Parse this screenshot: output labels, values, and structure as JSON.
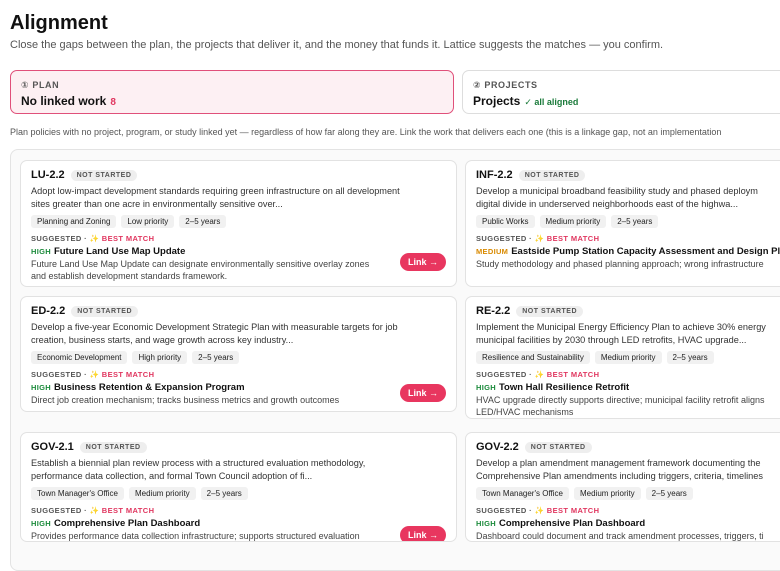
{
  "header": {
    "title": "Alignment",
    "subtitle": "Close the gaps between the plan, the projects that deliver it, and the money that funds it. Lattice suggests the matches — you confirm."
  },
  "tabs": {
    "plan": {
      "index": "①",
      "eyebrow": "PLAN",
      "label": "No linked work",
      "count": "8"
    },
    "projects": {
      "index": "②",
      "eyebrow": "PROJECTS",
      "label": "Projects",
      "status": "✓ all aligned"
    }
  },
  "note": "Plan policies with no project, program, or study linked yet — regardless of how far along they are. Link the work that delivers each one (this is a linkage gap, not an implementation",
  "labels": {
    "suggested": "SUGGESTED ·",
    "spark": "✨",
    "best_match": "BEST MATCH",
    "link": "Link →"
  },
  "cards": [
    {
      "code": "LU-2.2",
      "status": "NOT STARTED",
      "desc1": "Adopt low-impact development standards requiring green infrastructure on all development",
      "desc2": "sites greater than one acre in environmentally sensitive over...",
      "tags": [
        "Planning and Zoning",
        "Low priority",
        "2–5 years"
      ],
      "priority": "HIGH",
      "match_title": "Future Land Use Map Update",
      "match_desc1": "Future Land Use Map Update can designate environmentally sensitive overlay zones",
      "match_desc2": "and establish development standards framework.",
      "show_link": true
    },
    {
      "code": "INF-2.2",
      "status": "NOT STARTED",
      "desc1": "Develop a municipal broadband feasibility study and phased deploym",
      "desc2": "digital divide in underserved neighborhoods east of the highwa...",
      "tags": [
        "Public Works",
        "Medium priority",
        "2–5 years"
      ],
      "priority": "MEDIUM",
      "match_title": "Eastside Pump Station Capacity Assessment and Design Plan",
      "match_desc1": "Study methodology and phased planning approach; wrong infrastructure",
      "match_desc2": "",
      "show_link": false
    },
    {
      "code": "ED-2.2",
      "status": "NOT STARTED",
      "desc1": "Develop a five-year Economic Development Strategic Plan with measurable targets for job",
      "desc2": "creation, business starts, and wage growth across key industry...",
      "tags": [
        "Economic Development",
        "High priority",
        "2–5 years"
      ],
      "priority": "HIGH",
      "match_title": "Business Retention & Expansion Program",
      "match_desc1": "Direct job creation mechanism; tracks business metrics and growth outcomes",
      "match_desc2": "",
      "show_link": true
    },
    {
      "code": "RE-2.2",
      "status": "NOT STARTED",
      "desc1": "Implement the Municipal Energy Efficiency Plan to achieve 30% energy",
      "desc2": "municipal facilities by 2030 through LED retrofits, HVAC upgrade...",
      "tags": [
        "Resilience and Sustainability",
        "Medium priority",
        "2–5 years"
      ],
      "priority": "HIGH",
      "match_title": "Town Hall Resilience Retrofit",
      "match_desc1": "HVAC upgrade directly supports directive; municipal facility retrofit aligns",
      "match_desc2": "LED/HVAC mechanisms",
      "show_link": false
    },
    {
      "code": "GOV-2.1",
      "status": "NOT STARTED",
      "desc1": "Establish a biennial plan review process with a structured evaluation methodology,",
      "desc2": "performance data collection, and formal Town Council adoption of fi...",
      "tags": [
        "Town Manager's Office",
        "Medium priority",
        "2–5 years"
      ],
      "priority": "HIGH",
      "match_title": "Comprehensive Plan Dashboard",
      "match_desc1": "Provides performance data collection infrastructure; supports structured evaluation",
      "match_desc2": "",
      "show_link": true
    },
    {
      "code": "GOV-2.2",
      "status": "NOT STARTED",
      "desc1": "Develop a plan amendment management framework documenting the",
      "desc2": "Comprehensive Plan amendments including triggers, criteria, timelines",
      "tags": [
        "Town Manager's Office",
        "Medium priority",
        "2–5 years"
      ],
      "priority": "HIGH",
      "match_title": "Comprehensive Plan Dashboard",
      "match_desc1": "Dashboard could document and track amendment processes, triggers, ti",
      "match_desc2": "",
      "show_link": false
    }
  ]
}
